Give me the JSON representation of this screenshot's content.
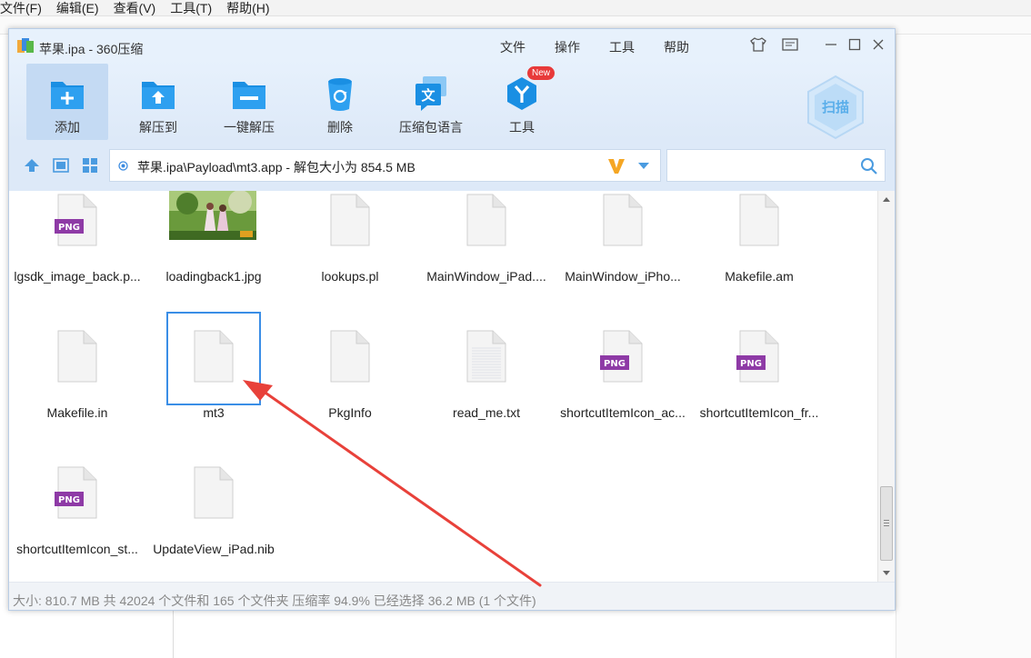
{
  "bg_menu": [
    "文件(F)",
    "编辑(E)",
    "查看(V)",
    "工具(T)",
    "帮助(H)"
  ],
  "window": {
    "title": "苹果.ipa - 360压缩",
    "menu": [
      "文件",
      "操作",
      "工具",
      "帮助"
    ]
  },
  "toolbar": {
    "buttons": [
      {
        "label": "添加",
        "icon": "add-folder-icon"
      },
      {
        "label": "解压到",
        "icon": "extract-to-folder-icon"
      },
      {
        "label": "一键解压",
        "icon": "one-click-extract-icon"
      },
      {
        "label": "删除",
        "icon": "recycle-bin-icon"
      },
      {
        "label": "压缩包语言",
        "icon": "language-icon"
      },
      {
        "label": "工具",
        "icon": "tools-icon"
      }
    ],
    "new_badge": "New",
    "scan_label": "扫描"
  },
  "path": {
    "text": "苹果.ipa\\Payload\\mt3.app - 解包大小为 854.5 MB"
  },
  "files": [
    {
      "name": "lgsdk_image_back.p...",
      "type": "png"
    },
    {
      "name": "loadingback1.jpg",
      "type": "jpg"
    },
    {
      "name": "lookups.pl",
      "type": "file"
    },
    {
      "name": "MainWindow_iPad....",
      "type": "file"
    },
    {
      "name": "MainWindow_iPho...",
      "type": "file"
    },
    {
      "name": "Makefile.am",
      "type": "file"
    },
    {
      "name": "Makefile.in",
      "type": "file"
    },
    {
      "name": "mt3",
      "type": "file",
      "selected": true
    },
    {
      "name": "PkgInfo",
      "type": "file"
    },
    {
      "name": "read_me.txt",
      "type": "txt"
    },
    {
      "name": "shortcutItemIcon_ac...",
      "type": "png"
    },
    {
      "name": "shortcutItemIcon_fr...",
      "type": "png"
    },
    {
      "name": "shortcutItemIcon_st...",
      "type": "png"
    },
    {
      "name": "UpdateView_iPad.nib",
      "type": "file"
    }
  ],
  "png_label": "PNG",
  "status": "大小: 810.7 MB 共 42024 个文件和 165 个文件夹 压缩率 94.9% 已经选择 36.2 MB (1 个文件)",
  "colors": {
    "accent": "#1a8fe3",
    "select": "#3a8ee6",
    "annotation_arrow": "#e8413a"
  }
}
